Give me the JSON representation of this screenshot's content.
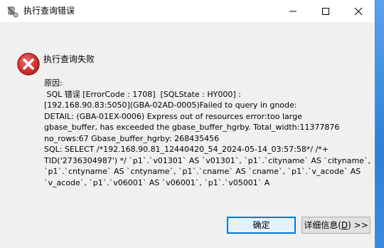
{
  "window": {
    "title": "执行查询错误",
    "icon": "database-app-icon"
  },
  "dialog": {
    "heading": "执行查询失败",
    "icon": "error-icon",
    "message_lines": [
      "原因:",
      " SQL 错误 [ErrorCode : 1708]  [SQLState : HY000] :",
      "[192.168.90.83:5050](GBA-02AD-0005)Failed to query in gnode:",
      "DETAIL: (GBA-01EX-0006) Express out of resources error:too large",
      "gbase_buffer, has exceeded the gbase_buffer_hgrby. Total_width:11377876",
      "no_rows:67 Gbase_buffer_hgrby: 268435456",
      "SQL: SELECT /*192.168.90.81_12440420_54_2024-05-14_03:57:58*/ /*+",
      "TID('2736304987') */ `p1`.`v01301` AS `v01301`, `p1`.`cityname` AS `cityname`,",
      "`p1`.`cntyname` AS `cntyname`, `p1`.`cname` AS `cname`, `p1`.`v_acode` AS",
      "`v_acode`, `p1`.`v06001` AS `v06001`, `p1`.`v05001` A"
    ]
  },
  "buttons": {
    "ok_label": "确定",
    "details_label_pre": "详细信息(",
    "details_label_key": "D",
    "details_label_post": ") >>"
  },
  "colors": {
    "accent": "#0078d7",
    "error_red": "#d32f2f"
  }
}
